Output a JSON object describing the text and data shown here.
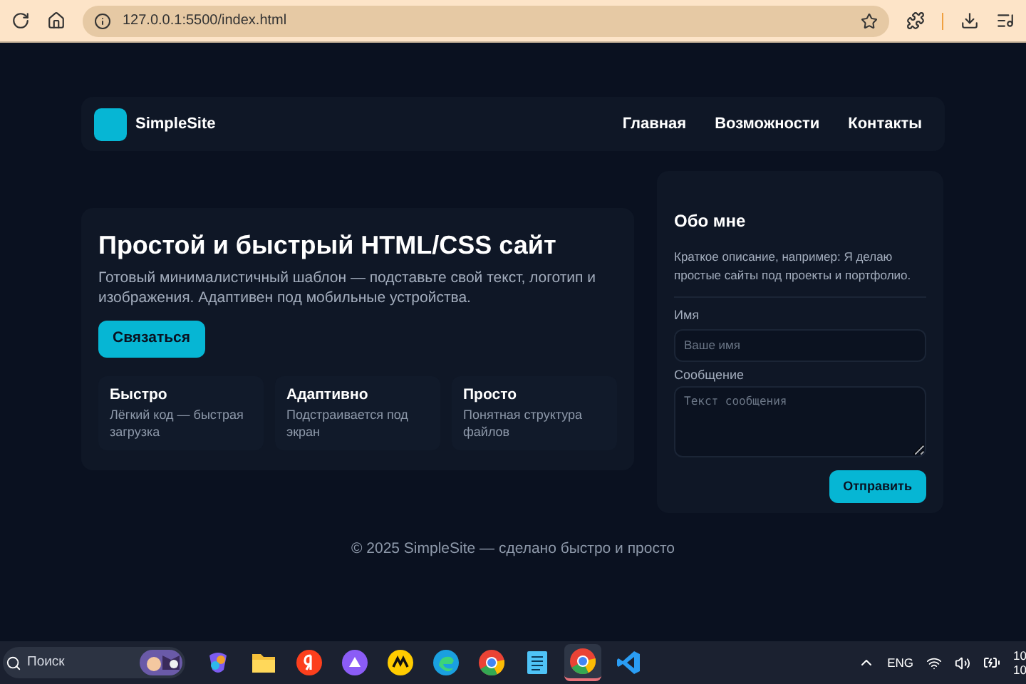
{
  "browser": {
    "url": "127.0.0.1:5500/index.html"
  },
  "header": {
    "logo_text": "SimpleSite",
    "nav": [
      {
        "label": "Главная"
      },
      {
        "label": "Возможности"
      },
      {
        "label": "Контакты"
      }
    ]
  },
  "hero": {
    "title": "Простой и быстрый HTML/CSS сайт",
    "text": "Готовый минималистичный шаблон — подставьте свой текст, логотип и изображения. Адаптивен под мобильные устройства.",
    "button": "Связаться",
    "features": [
      {
        "title": "Быстро",
        "text": "Лёгкий код — быстрая загрузка"
      },
      {
        "title": "Адаптивно",
        "text": "Подстраивается под экран"
      },
      {
        "title": "Просто",
        "text": "Понятная структура файлов"
      }
    ]
  },
  "about": {
    "title": "Обо мне",
    "text": "Краткое описание, например: Я делаю простые сайты под проекты и портфолио.",
    "name_label": "Имя",
    "name_placeholder": "Ваше имя",
    "message_label": "Сообщение",
    "message_placeholder": "Текст сообщения",
    "submit": "Отправить"
  },
  "footer": "© 2025 SimpleSite — сделано быстро и просто",
  "taskbar": {
    "search_placeholder": "Поиск",
    "apps": [
      {
        "kind": "copilot",
        "selected": false
      },
      {
        "kind": "folder",
        "selected": false
      },
      {
        "kind": "yandex",
        "selected": false
      },
      {
        "kind": "alice",
        "selected": false
      },
      {
        "kind": "market",
        "selected": false
      },
      {
        "kind": "edge",
        "selected": false
      },
      {
        "kind": "chrome",
        "selected": false
      },
      {
        "kind": "notepad",
        "selected": false
      },
      {
        "kind": "chrome",
        "selected": true
      },
      {
        "kind": "vscode",
        "selected": false
      }
    ],
    "language": "ENG",
    "clock_time": "10",
    "clock_date": "10"
  }
}
